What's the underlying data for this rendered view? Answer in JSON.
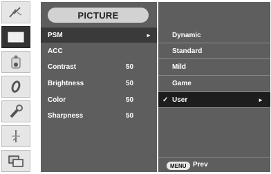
{
  "menu": {
    "title": "PICTURE",
    "items": [
      {
        "label": "PSM",
        "value": "",
        "arrow": "►"
      },
      {
        "label": "ACC",
        "value": ""
      },
      {
        "label": "Contrast",
        "value": "50"
      },
      {
        "label": "Brightness",
        "value": "50"
      },
      {
        "label": "Color",
        "value": "50"
      },
      {
        "label": "Sharpness",
        "value": "50"
      }
    ]
  },
  "submenu": {
    "options": [
      {
        "label": "Dynamic"
      },
      {
        "label": "Standard"
      },
      {
        "label": "Mild"
      },
      {
        "label": "Game"
      },
      {
        "label": "User",
        "check": "✓",
        "arrow": "►"
      }
    ],
    "footer": {
      "button": "MENU",
      "label": "Prev"
    }
  },
  "sidebar": {
    "icons": [
      "picture-adjust-icon",
      "screen-icon",
      "color-icon",
      "tracking-icon",
      "setup-icon",
      "input-icon",
      "pip-icon"
    ]
  },
  "colors": {
    "panel": "#5e5e5e",
    "selected": "#1d1d1d",
    "pill": "#d2d2d2"
  }
}
